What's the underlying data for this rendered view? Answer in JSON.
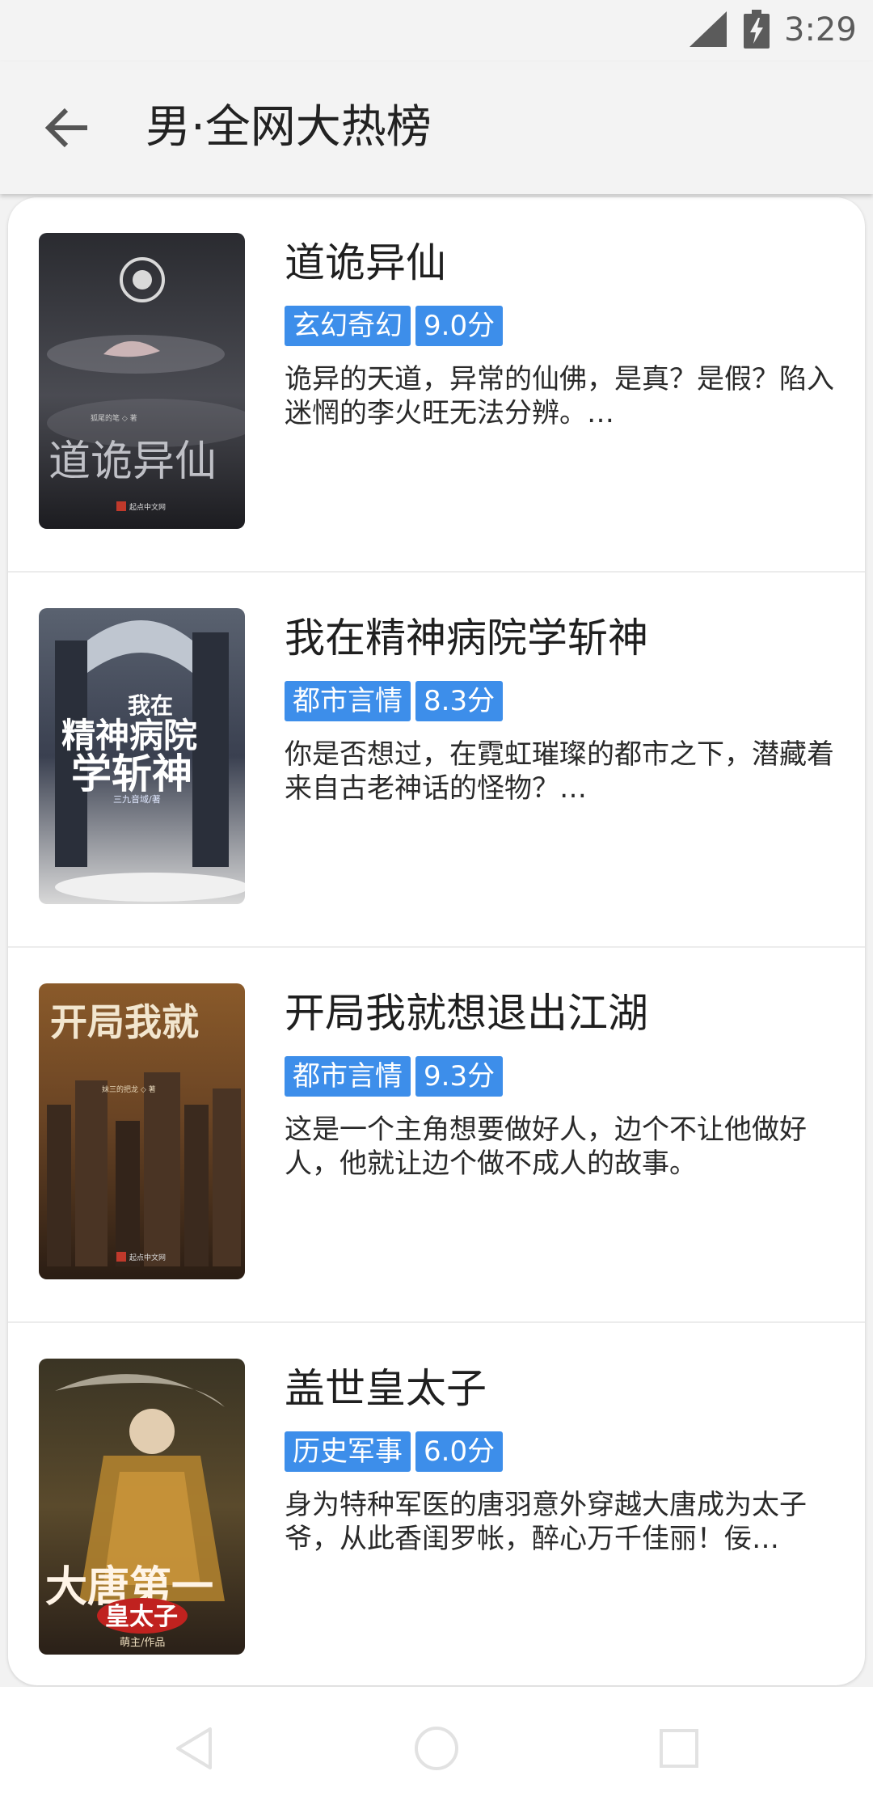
{
  "status_bar": {
    "time": "3:29",
    "icons": [
      "signal-icon",
      "battery-charging-icon"
    ]
  },
  "header": {
    "title": "男·全网大热榜",
    "back_icon": "arrow-left-icon"
  },
  "books": [
    {
      "title": "道诡异仙",
      "genre": "玄幻奇幻",
      "score": "9.0分",
      "description": "诡异的天道，异常的仙佛，是真？是假？陷入迷惘的李火旺无法分辨。…",
      "cover": {
        "title_text": "道诡异仙",
        "author_text": "狐尾的笔 ◇ 著",
        "publisher_text": "起点中文网"
      }
    },
    {
      "title": "我在精神病院学斩神",
      "genre": "都市言情",
      "score": "8.3分",
      "description": "你是否想过，在霓虹璀璨的都市之下，潜藏着来自古老神话的怪物？…",
      "cover": {
        "title_top": "我在",
        "title_mid": "精神病院",
        "title_bot": "学斩神",
        "author_text": "三九音域/著"
      }
    },
    {
      "title": "开局我就想退出江湖",
      "genre": "都市言情",
      "score": "9.3分",
      "description": "这是一个主角想要做好人，边个不让他做好人，他就让边个做不成人的故事。",
      "cover": {
        "title_text": "开局我就",
        "author_text": "妹三的把龙 ◇ 著",
        "publisher_text": "起点中文网"
      }
    },
    {
      "title": "盖世皇太子",
      "genre": "历史军事",
      "score": "6.0分",
      "description": "身为特种军医的唐羽意外穿越大唐成为太子爷，从此香闺罗帐，醉心万千佳丽！佞…",
      "cover": {
        "title_text": "大唐第一",
        "subtitle_text": "皇太子",
        "author_text": "萌主/作品"
      }
    }
  ],
  "nav_bar": {
    "icons": [
      "back-triangle-icon",
      "home-circle-icon",
      "recents-square-icon"
    ]
  },
  "colors": {
    "tag_bg": "#3d8eea",
    "background": "#f2f2f2",
    "card": "#ffffff"
  }
}
